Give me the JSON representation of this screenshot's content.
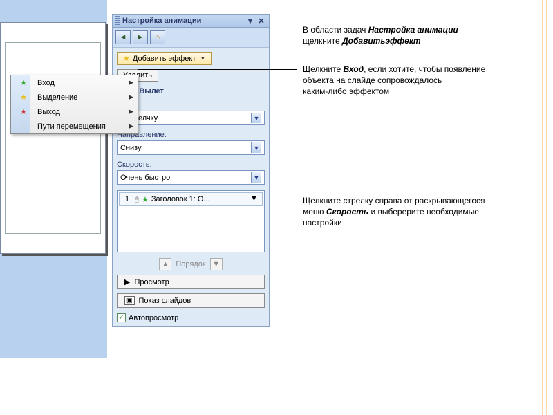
{
  "pane": {
    "title": "Настройка анимации",
    "add_effect": "Добавить эффект",
    "remove": "Удалить",
    "change_label": "ение: Вылет",
    "start_label": "ло:",
    "start_value": "По щелчку",
    "direction_label": "Направление:",
    "direction_value": "Снизу",
    "speed_label": "Скорость:",
    "speed_value": "Очень быстро",
    "list_item_num": "1",
    "list_item_text": "Заголовок 1: О...",
    "order_label": "Порядок",
    "preview": "Просмотр",
    "slideshow": "Показ слайдов",
    "autopreview": "Автопросмотр"
  },
  "flyout": {
    "entry": "Вход",
    "emphasis": "Выделение",
    "exit": "Выход",
    "motion": "Пути перемещения"
  },
  "anno": {
    "a1_line1": "В области задач ",
    "a1_bold1": "Настройка анимации",
    "a1_line2a": "щелкните ",
    "a1_bold2": "Добавитьэффект",
    "a2_line1a": "Щелкните ",
    "a2_bold": "Вход",
    "a2_line1b": ", если хотите, чтобы появление",
    "a2_line2": "объекта на слайде сопровождалось",
    "a2_line3": "каким-либо эффектом",
    "a3_line1": "Щелкните стрелку справа от раскрывающегося",
    "a3_line2a": "меню ",
    "a3_bold": "Скорость",
    "a3_line2b": " и выберерите необходимые",
    "a3_line3": "настройки"
  }
}
